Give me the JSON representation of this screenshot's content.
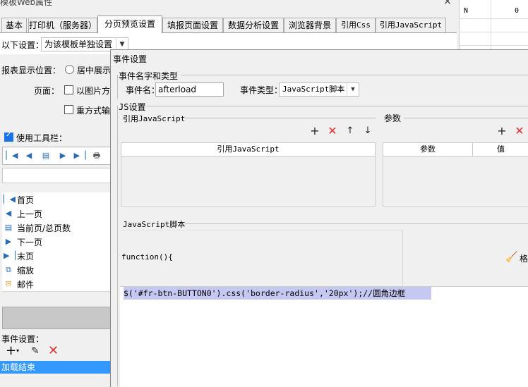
{
  "back_window": {
    "title": "模板Web属性",
    "close": "×",
    "grid_col": "N",
    "grid_val": "0",
    "tabs": [
      {
        "label": "基本"
      },
      {
        "label": "打印机（服务器）"
      },
      {
        "label": "分页预览设置",
        "active": true
      },
      {
        "label": "填报页面设置"
      },
      {
        "label": "数据分析设置"
      },
      {
        "label": "浏览器背景"
      },
      {
        "label": "引用Css"
      },
      {
        "label": "引用JavaScript"
      }
    ],
    "settings_label": "以下设置：",
    "settings_value": "为该模板单独设置",
    "report_display_label": "报表显示位置：",
    "report_display_option": "居中展示",
    "page_label": "页面：",
    "page_option1": "以图片方式",
    "page_option2": "重方式输出",
    "use_toolbar_label": "使用工具栏：",
    "toolbar_items": [
      {
        "icon": "first-page-icon",
        "label": "首页"
      },
      {
        "icon": "prev-page-icon",
        "label": "上一页"
      },
      {
        "icon": "page-count-icon",
        "label": "当前页/总页数"
      },
      {
        "icon": "next-page-icon",
        "label": "下一页"
      },
      {
        "icon": "last-page-icon",
        "label": "末页"
      },
      {
        "icon": "zoom-icon",
        "label": "缩放"
      },
      {
        "icon": "mail-icon",
        "label": "邮件"
      }
    ],
    "event_settings_label": "事件设置：",
    "event_selected": "加载结束"
  },
  "dialog": {
    "title": "事件设置",
    "name_type_group": "事件名字和类型",
    "event_name_label": "事件名：",
    "event_name_value": "afterload",
    "event_type_label": "事件类型：",
    "event_type_value": "JavaScript脚本",
    "js_group": "JS设置",
    "ref_js_label": "引用JavaScript",
    "ref_js_col": "引用JavaScript",
    "params_label": "参数",
    "params_col1": "参数",
    "params_col2": "值",
    "script_label": "JavaScript脚本",
    "function_header": "function(){",
    "format_label": "格",
    "code_line": "$('#fr-btn-BUTTON0').css('border-radius','20px');//圆角边框"
  }
}
